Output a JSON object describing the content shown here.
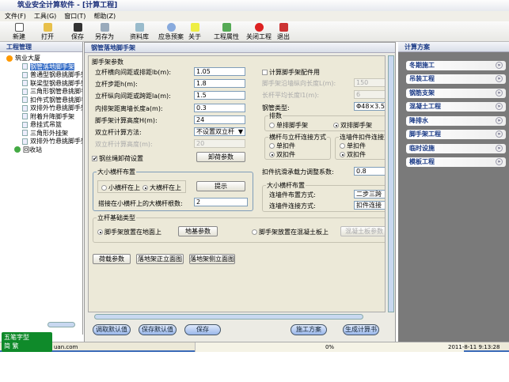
{
  "window": {
    "title": "筑业安全计算软件 - [计算工程]"
  },
  "menu": [
    "文件(F)",
    "工具(G)",
    "窗口(T)",
    "帮助(Z)"
  ],
  "toolbar": [
    "新建",
    "打开",
    "保存",
    "另存为",
    "资料库",
    "应急预案",
    "关于",
    "工程属性",
    "关闭工程",
    "退出"
  ],
  "left": {
    "title": "工程管理",
    "root": "筑业大厦",
    "items": [
      "钢管落地脚手架",
      "普通型钢悬挑脚手架",
      "联梁型钢悬挑脚手架",
      "三角形钢管悬挑脚手架",
      "扣件式钢管悬挑脚手架",
      "双排外竹悬挑脚手架",
      "附着升降脚手架",
      "悬挂式吊篮",
      "三角形外挂架",
      "双排外竹悬挑脚手架"
    ],
    "recycle": "回收站"
  },
  "main": {
    "title": "钢管落地脚手架",
    "group_params": "脚手架参数",
    "fields": [
      {
        "label": "立杆横向间距或排距lb(m):",
        "value": "1.05"
      },
      {
        "label": "立杆步距h(m):",
        "value": "1.8"
      },
      {
        "label": "立杆纵向间距或跨距la(m):",
        "value": "1.5"
      },
      {
        "label": "内排架距离墙长度a(m):",
        "value": "0.3"
      },
      {
        "label": "脚手架计算高度H(m):",
        "value": "24"
      }
    ],
    "double_pole_label": "双立杆计算方法:",
    "double_pole_value": "不设置双立杆",
    "double_pole_height_label": "双立杆计算高度(m):",
    "double_pole_height_value": "20",
    "wire_check": "钢丝绳卸荷设置",
    "unload_btn": "卸荷参数",
    "accessory_check": "计算脚手架配件用",
    "acc_len_label": "脚手架沿墙纵向长度L(m):",
    "acc_len_value": "150",
    "bar_len_label": "长杆平均长度l1(m):",
    "bar_len_value": "6",
    "pipe_label": "钢管类型:",
    "pipe_value": "Φ48×3.5",
    "rows_group": "排数",
    "rows_opts": [
      "单排脚手架",
      "双排脚手架"
    ],
    "conn_group": "横杆与立杆连接方式",
    "conn_opts": [
      "单扣件",
      "双扣件"
    ],
    "wall_group": "连墙件扣件连接方式",
    "wall_opts": [
      "单扣件",
      "双扣件"
    ],
    "slip_label": "扣件抗滑承载力调整系数:",
    "slip_value": "0.8",
    "bar_group": "大小横杆布置",
    "bar_opts": [
      "小横杆在上",
      "大横杆在上"
    ],
    "hint_btn": "提示",
    "bar_count_label": "搭接在小横杆上的大横杆根数:",
    "bar_count_value": "2",
    "wall_layout_group": "大小横杆布置",
    "wall_layout_label": "连墙件布置方式:",
    "wall_layout_value": "二步三跨",
    "wall_conn_label": "连墙件连接方式:",
    "wall_conn_value": "扣件连接",
    "base_group": "立杆基础类型",
    "base_opt1": "脚手架放置在地面上",
    "base_btn1": "地基参数",
    "base_opt2": "脚手架放置在混凝土板上",
    "base_btn2": "混凝土板参数",
    "bottom_btns": [
      "荷载参数",
      "落地架正立面图",
      "落地架侧立面图"
    ],
    "pills": [
      "调取默认值",
      "保存默认值",
      "保存",
      "施工方案",
      "生成计算书"
    ]
  },
  "right": {
    "title": "计算方案",
    "items": [
      "冬期施工",
      "吊装工程",
      "钢筋支架",
      "混凝土工程",
      "降排水",
      "脚手架工程",
      "临时设施",
      "模板工程"
    ]
  },
  "status": {
    "site": "uan.com",
    "progress": "0%",
    "datetime": "2011-8-11 9:13:28"
  },
  "ime": {
    "line1": "五笔字型",
    "line2": "简 繁"
  }
}
